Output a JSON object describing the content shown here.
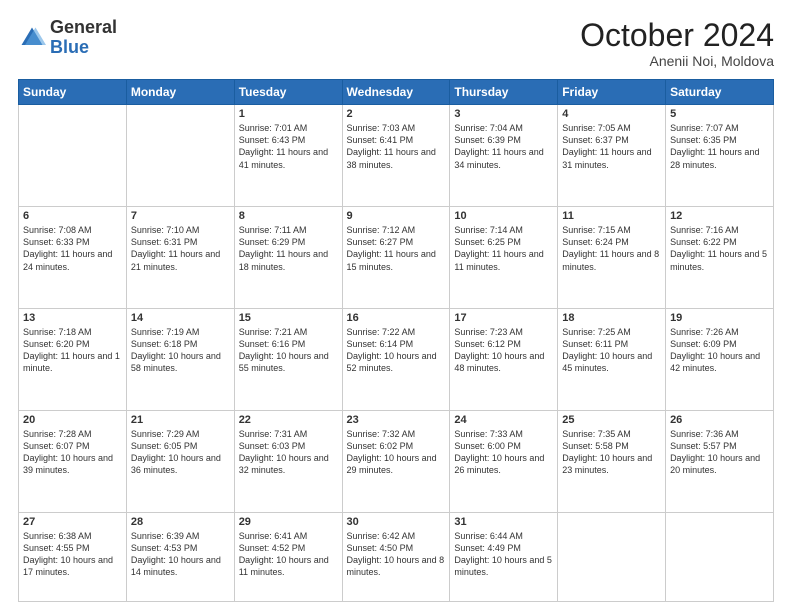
{
  "header": {
    "logo_general": "General",
    "logo_blue": "Blue",
    "month_title": "October 2024",
    "subtitle": "Anenii Noi, Moldova"
  },
  "weekdays": [
    "Sunday",
    "Monday",
    "Tuesday",
    "Wednesday",
    "Thursday",
    "Friday",
    "Saturday"
  ],
  "weeks": [
    [
      {
        "date": "",
        "info": ""
      },
      {
        "date": "",
        "info": ""
      },
      {
        "date": "1",
        "info": "Sunrise: 7:01 AM\nSunset: 6:43 PM\nDaylight: 11 hours and 41 minutes."
      },
      {
        "date": "2",
        "info": "Sunrise: 7:03 AM\nSunset: 6:41 PM\nDaylight: 11 hours and 38 minutes."
      },
      {
        "date": "3",
        "info": "Sunrise: 7:04 AM\nSunset: 6:39 PM\nDaylight: 11 hours and 34 minutes."
      },
      {
        "date": "4",
        "info": "Sunrise: 7:05 AM\nSunset: 6:37 PM\nDaylight: 11 hours and 31 minutes."
      },
      {
        "date": "5",
        "info": "Sunrise: 7:07 AM\nSunset: 6:35 PM\nDaylight: 11 hours and 28 minutes."
      }
    ],
    [
      {
        "date": "6",
        "info": "Sunrise: 7:08 AM\nSunset: 6:33 PM\nDaylight: 11 hours and 24 minutes."
      },
      {
        "date": "7",
        "info": "Sunrise: 7:10 AM\nSunset: 6:31 PM\nDaylight: 11 hours and 21 minutes."
      },
      {
        "date": "8",
        "info": "Sunrise: 7:11 AM\nSunset: 6:29 PM\nDaylight: 11 hours and 18 minutes."
      },
      {
        "date": "9",
        "info": "Sunrise: 7:12 AM\nSunset: 6:27 PM\nDaylight: 11 hours and 15 minutes."
      },
      {
        "date": "10",
        "info": "Sunrise: 7:14 AM\nSunset: 6:25 PM\nDaylight: 11 hours and 11 minutes."
      },
      {
        "date": "11",
        "info": "Sunrise: 7:15 AM\nSunset: 6:24 PM\nDaylight: 11 hours and 8 minutes."
      },
      {
        "date": "12",
        "info": "Sunrise: 7:16 AM\nSunset: 6:22 PM\nDaylight: 11 hours and 5 minutes."
      }
    ],
    [
      {
        "date": "13",
        "info": "Sunrise: 7:18 AM\nSunset: 6:20 PM\nDaylight: 11 hours and 1 minute."
      },
      {
        "date": "14",
        "info": "Sunrise: 7:19 AM\nSunset: 6:18 PM\nDaylight: 10 hours and 58 minutes."
      },
      {
        "date": "15",
        "info": "Sunrise: 7:21 AM\nSunset: 6:16 PM\nDaylight: 10 hours and 55 minutes."
      },
      {
        "date": "16",
        "info": "Sunrise: 7:22 AM\nSunset: 6:14 PM\nDaylight: 10 hours and 52 minutes."
      },
      {
        "date": "17",
        "info": "Sunrise: 7:23 AM\nSunset: 6:12 PM\nDaylight: 10 hours and 48 minutes."
      },
      {
        "date": "18",
        "info": "Sunrise: 7:25 AM\nSunset: 6:11 PM\nDaylight: 10 hours and 45 minutes."
      },
      {
        "date": "19",
        "info": "Sunrise: 7:26 AM\nSunset: 6:09 PM\nDaylight: 10 hours and 42 minutes."
      }
    ],
    [
      {
        "date": "20",
        "info": "Sunrise: 7:28 AM\nSunset: 6:07 PM\nDaylight: 10 hours and 39 minutes."
      },
      {
        "date": "21",
        "info": "Sunrise: 7:29 AM\nSunset: 6:05 PM\nDaylight: 10 hours and 36 minutes."
      },
      {
        "date": "22",
        "info": "Sunrise: 7:31 AM\nSunset: 6:03 PM\nDaylight: 10 hours and 32 minutes."
      },
      {
        "date": "23",
        "info": "Sunrise: 7:32 AM\nSunset: 6:02 PM\nDaylight: 10 hours and 29 minutes."
      },
      {
        "date": "24",
        "info": "Sunrise: 7:33 AM\nSunset: 6:00 PM\nDaylight: 10 hours and 26 minutes."
      },
      {
        "date": "25",
        "info": "Sunrise: 7:35 AM\nSunset: 5:58 PM\nDaylight: 10 hours and 23 minutes."
      },
      {
        "date": "26",
        "info": "Sunrise: 7:36 AM\nSunset: 5:57 PM\nDaylight: 10 hours and 20 minutes."
      }
    ],
    [
      {
        "date": "27",
        "info": "Sunrise: 6:38 AM\nSunset: 4:55 PM\nDaylight: 10 hours and 17 minutes."
      },
      {
        "date": "28",
        "info": "Sunrise: 6:39 AM\nSunset: 4:53 PM\nDaylight: 10 hours and 14 minutes."
      },
      {
        "date": "29",
        "info": "Sunrise: 6:41 AM\nSunset: 4:52 PM\nDaylight: 10 hours and 11 minutes."
      },
      {
        "date": "30",
        "info": "Sunrise: 6:42 AM\nSunset: 4:50 PM\nDaylight: 10 hours and 8 minutes."
      },
      {
        "date": "31",
        "info": "Sunrise: 6:44 AM\nSunset: 4:49 PM\nDaylight: 10 hours and 5 minutes."
      },
      {
        "date": "",
        "info": ""
      },
      {
        "date": "",
        "info": ""
      }
    ]
  ]
}
